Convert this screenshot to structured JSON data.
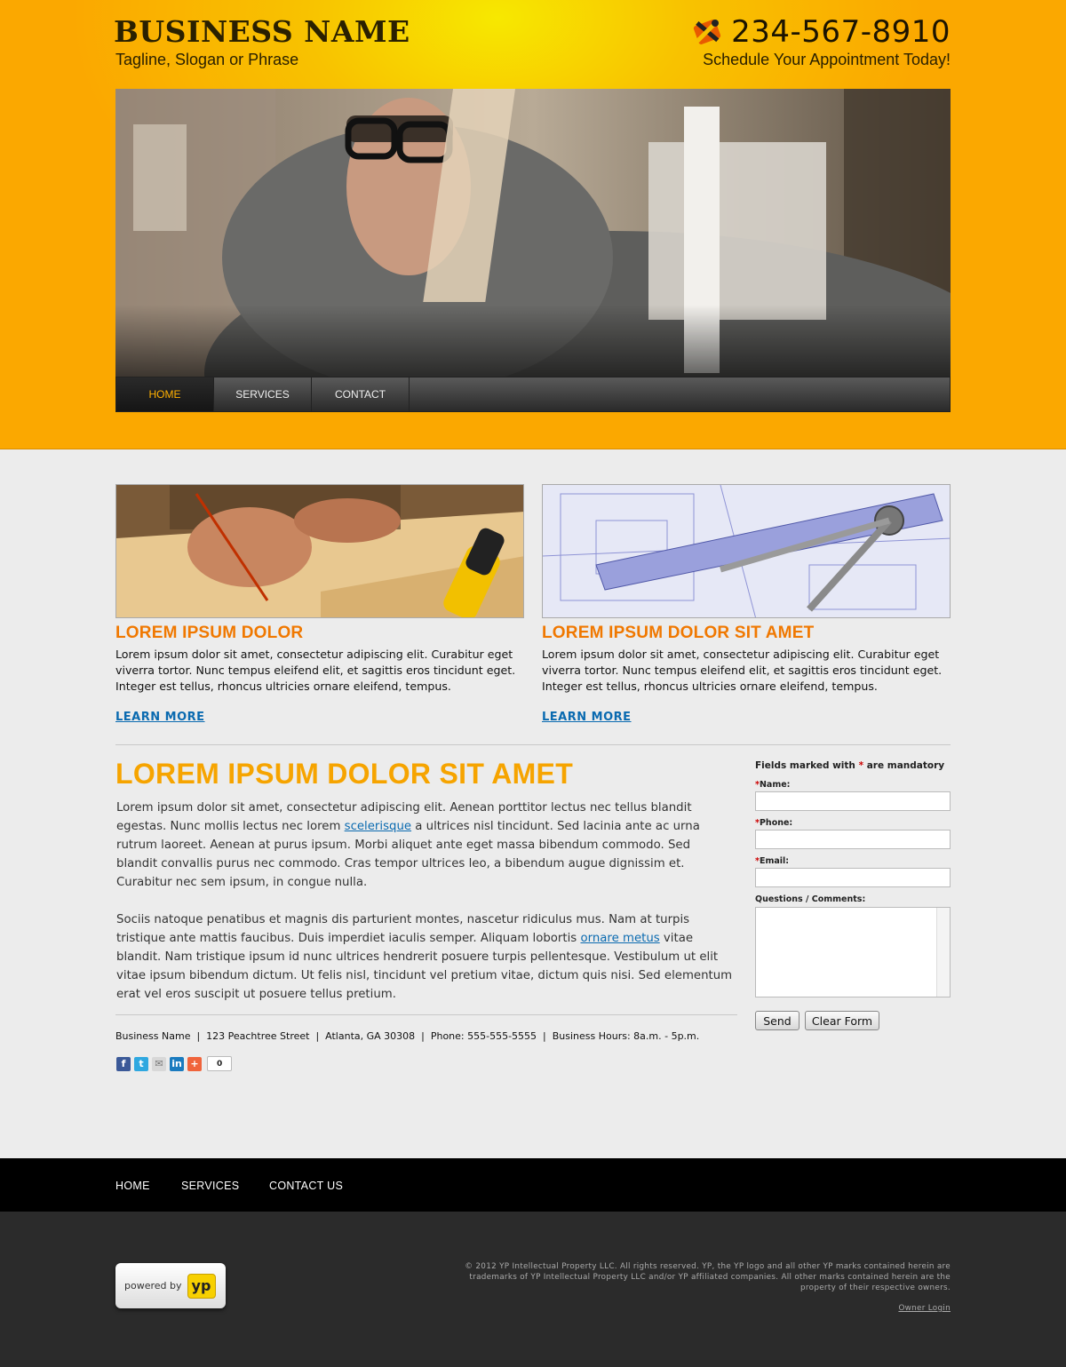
{
  "header": {
    "business_name": "BUSINESS NAME",
    "tagline": "Tagline, Slogan or Phrase",
    "phone": "234-567-8910",
    "schedule": "Schedule Your Appointment Today!"
  },
  "nav": {
    "items": [
      {
        "label": "HOME",
        "active": true
      },
      {
        "label": "SERVICES",
        "active": false
      },
      {
        "label": "CONTACT",
        "active": false
      }
    ]
  },
  "cards": [
    {
      "title": "LOREM IPSUM DOLOR",
      "text": "Lorem ipsum dolor sit amet, consectetur adipiscing elit. Curabitur eget viverra tortor. Nunc tempus eleifend elit, et sagittis eros tincidunt eget. Integer est tellus, rhoncus ultricies ornare eleifend, tempus.",
      "link": "LEARN MORE"
    },
    {
      "title": "LOREM IPSUM DOLOR SIT AMET",
      "text": "Lorem ipsum dolor sit amet, consectetur adipiscing elit. Curabitur eget viverra tortor. Nunc tempus eleifend elit, et sagittis eros tincidunt eget. Integer est tellus, rhoncus ultricies ornare eleifend, tempus.",
      "link": "LEARN MORE"
    }
  ],
  "main": {
    "title": "LOREM IPSUM DOLOR SIT AMET",
    "p1_a": "Lorem ipsum dolor sit amet, consectetur adipiscing elit. Aenean porttitor lectus nec tellus blandit egestas. Nunc mollis lectus nec lorem ",
    "p1_link": "scelerisque",
    "p1_b": " a ultrices nisl tincidunt. Sed lacinia ante ac urna rutrum laoreet. Aenean at purus ipsum. Morbi aliquet ante eget massa bibendum commodo. Sed blandit convallis purus nec commodo. Cras tempor ultrices leo, a bibendum augue dignissim et. Curabitur nec sem ipsum, in congue nulla.",
    "p2_a": "Sociis natoque penatibus et magnis dis parturient montes, nascetur ridiculus mus. Nam at turpis tristique ante mattis faucibus. Duis imperdiet iaculis semper. Aliquam lobortis ",
    "p2_link": "ornare metus",
    "p2_b": " vitae blandit. Nam tristique ipsum id nunc ultrices hendrerit posuere turpis pellentesque. Vestibulum ut elit vitae ipsum bibendum dictum. Ut felis nisl, tincidunt vel pretium vitae, dictum quis nisi. Sed elementum erat vel eros suscipit ut posuere tellus pretium.",
    "business_line": "Business Name  |  123 Peachtree Street  |  Atlanta, GA 30308  |  Phone: 555-555-5555  |  Business Hours: 8a.m. - 5p.m.",
    "share_count": "0"
  },
  "form": {
    "note_a": "Fields marked with ",
    "note_star": "*",
    "note_b": " are mandatory",
    "name_label": "Name:",
    "phone_label": "Phone:",
    "email_label": "Email:",
    "comments_label": "Questions / Comments:",
    "send": "Send",
    "clear": "Clear Form"
  },
  "footer": {
    "nav": [
      "HOME",
      "SERVICES",
      "CONTACT US"
    ],
    "powered_by": "powered by",
    "yp": "yp",
    "legal": "© 2012  YP Intellectual Property LLC. All rights reserved. YP, the YP logo and all other YP marks contained herein are trademarks of YP Intellectual Property LLC and/or YP affiliated companies. All other marks contained herein are the property of their respective owners.",
    "owner_login": "Owner Login"
  },
  "colors": {
    "accent_orange": "#f07800",
    "title_orange": "#f6a400",
    "link_blue": "#0a6ab0",
    "header_yellow": "#f8c200"
  }
}
